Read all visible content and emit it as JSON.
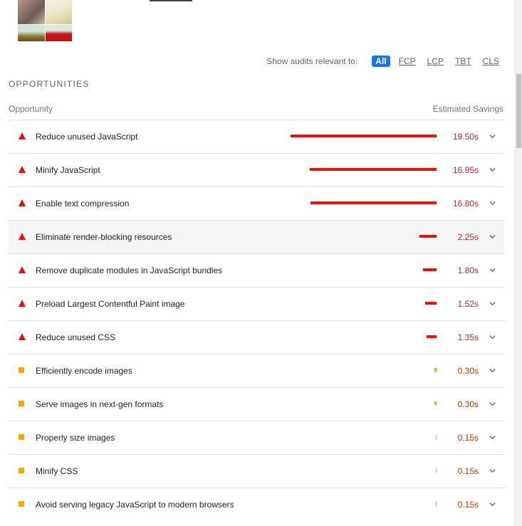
{
  "filter": {
    "label": "Show audits relevant to:",
    "chips": [
      "All",
      "FCP",
      "LCP",
      "TBT",
      "CLS"
    ],
    "active": "All"
  },
  "section_title": "OPPORTUNITIES",
  "columns": {
    "left": "Opportunity",
    "right": "Estimated Savings"
  },
  "colors": {
    "fail": "#eb0f00",
    "average": "#ffa400",
    "fail_text": "#c7221f",
    "accent": "#1a73e8"
  },
  "max_savings_s": 19.5,
  "opportunities": [
    {
      "title": "Reduce unused JavaScript",
      "savings": "19.50s",
      "seconds": 19.5,
      "severity": "fail",
      "icon": "warning-triangle-icon"
    },
    {
      "title": "Minify JavaScript",
      "savings": "16.95s",
      "seconds": 16.95,
      "severity": "fail",
      "icon": "warning-triangle-icon"
    },
    {
      "title": "Enable text compression",
      "savings": "16.80s",
      "seconds": 16.8,
      "severity": "fail",
      "icon": "warning-triangle-icon"
    },
    {
      "title": "Eliminate render-blocking resources",
      "savings": "2.25s",
      "seconds": 2.25,
      "severity": "fail",
      "icon": "warning-triangle-icon"
    },
    {
      "title": "Remove duplicate modules in JavaScript bundles",
      "savings": "1.80s",
      "seconds": 1.8,
      "severity": "fail",
      "icon": "warning-triangle-icon"
    },
    {
      "title": "Preload Largest Contentful Paint image",
      "savings": "1.52s",
      "seconds": 1.52,
      "severity": "fail",
      "icon": "warning-triangle-icon"
    },
    {
      "title": "Reduce unused CSS",
      "savings": "1.35s",
      "seconds": 1.35,
      "severity": "fail",
      "icon": "warning-triangle-icon"
    },
    {
      "title": "Efficiently encode images",
      "savings": "0.30s",
      "seconds": 0.3,
      "severity": "average",
      "icon": "average-square-icon"
    },
    {
      "title": "Serve images in next-gen formats",
      "savings": "0.30s",
      "seconds": 0.3,
      "severity": "average",
      "icon": "average-square-icon"
    },
    {
      "title": "Properly size images",
      "savings": "0.15s",
      "seconds": 0.15,
      "severity": "average",
      "icon": "average-square-icon"
    },
    {
      "title": "Minify CSS",
      "savings": "0.15s",
      "seconds": 0.15,
      "severity": "average",
      "icon": "average-square-icon"
    },
    {
      "title": "Avoid serving legacy JavaScript to modern browsers",
      "savings": "0.15s",
      "seconds": 0.15,
      "severity": "average",
      "icon": "average-square-icon"
    }
  ]
}
